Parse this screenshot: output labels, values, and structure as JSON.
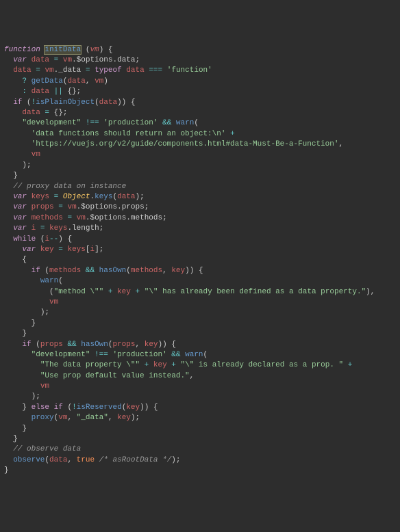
{
  "code": {
    "l1": {
      "kw": "function",
      "fn": "initData",
      "param": "vm"
    },
    "l2": {
      "kw": "var",
      "v": "data",
      "p1": "vm",
      "p2": "$options",
      "p3": "data"
    },
    "l3": {
      "v1": "data",
      "p1": "vm",
      "p2": "_data",
      "kw": "typeof",
      "v2": "data",
      "s": "'function'"
    },
    "l4": {
      "fn": "getData",
      "a1": "data",
      "a2": "vm"
    },
    "l5": {
      "v": "data"
    },
    "l6": {
      "kw": "if",
      "fn": "isPlainObject",
      "a": "data"
    },
    "l7": {
      "v": "data"
    },
    "l8": {
      "s1": "\"development\"",
      "s2": "'production'",
      "fn": "warn"
    },
    "l9": {
      "s": "'data functions should return an object:\\n'"
    },
    "l10": {
      "s": "'https://vuejs.org/v2/guide/components.html#data-Must-Be-a-Function'"
    },
    "l11": {
      "v": "vm"
    },
    "l12": {
      "c": "// proxy data on instance"
    },
    "l13": {
      "kw": "var",
      "v": "keys",
      "obj": "Object",
      "m": "keys",
      "a": "data"
    },
    "l14": {
      "kw": "var",
      "v": "props",
      "p1": "vm",
      "p2": "$options",
      "p3": "props"
    },
    "l15": {
      "kw": "var",
      "v": "methods",
      "p1": "vm",
      "p2": "$options",
      "p3": "methods"
    },
    "l16": {
      "kw": "var",
      "v": "i",
      "p1": "keys",
      "p2": "length"
    },
    "l17": {
      "kw": "while",
      "v": "i"
    },
    "l18": {
      "kw": "var",
      "v": "key",
      "p1": "keys",
      "p2": "i"
    },
    "l19": {
      "kw": "if",
      "v": "methods",
      "fn": "hasOwn",
      "a1": "methods",
      "a2": "key"
    },
    "l20": {
      "fn": "warn"
    },
    "l21": {
      "s1": "\"method \\\"\"",
      "v": "key",
      "s2": "\"\\\" has already been defined as a data property.\""
    },
    "l22": {
      "v": "vm"
    },
    "l23": {
      "kw": "if",
      "v": "props",
      "fn": "hasOwn",
      "a1": "props",
      "a2": "key"
    },
    "l24": {
      "s1": "\"development\"",
      "s2": "'production'",
      "fn": "warn"
    },
    "l25": {
      "s1": "\"The data property \\\"\"",
      "v": "key",
      "s2": "\"\\\" is already declared as a prop. \""
    },
    "l26": {
      "s": "\"Use prop default value instead.\""
    },
    "l27": {
      "v": "vm"
    },
    "l28": {
      "kw": "else if",
      "fn": "isReserved",
      "a": "key"
    },
    "l29": {
      "fn": "proxy",
      "a1": "vm",
      "s": "\"_data\"",
      "a2": "key"
    },
    "l30": {
      "c": "// observe data"
    },
    "l31": {
      "fn": "observe",
      "a": "data",
      "b": "true",
      "c": "/* asRootData */"
    }
  }
}
